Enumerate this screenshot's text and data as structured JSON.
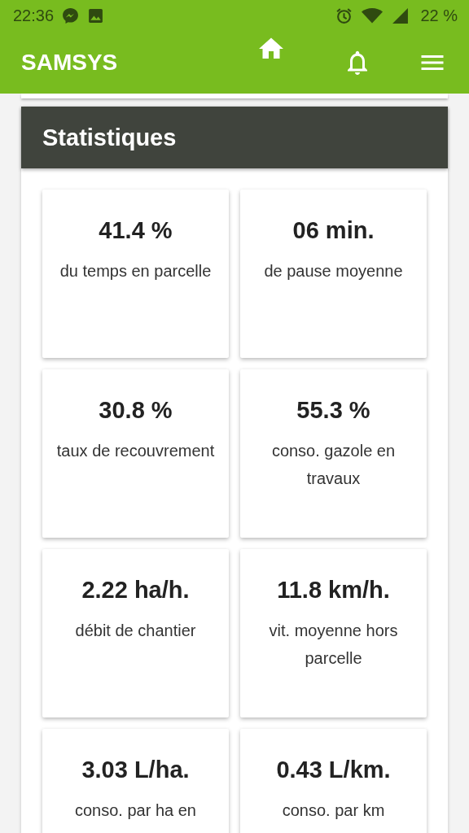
{
  "status_bar": {
    "time": "22:36",
    "battery": "22 %"
  },
  "app_bar": {
    "title": "SAMSYS"
  },
  "panel": {
    "title": "Statistiques",
    "stats": [
      {
        "value": "41.4 %",
        "label": "du temps en parcelle"
      },
      {
        "value": "06 min.",
        "label": "de pause moyenne"
      },
      {
        "value": "30.8 %",
        "label": "taux de recouvrement"
      },
      {
        "value": "55.3 %",
        "label": "conso. gazole en travaux"
      },
      {
        "value": "2.22 ha/h.",
        "label": "débit de chantier"
      },
      {
        "value": "11.8 km/h.",
        "label": "vit. moyenne hors parcelle"
      },
      {
        "value": "3.03 L/ha.",
        "label": "conso. par ha en"
      },
      {
        "value": "0.43 L/km.",
        "label": "conso. par km"
      }
    ]
  }
}
